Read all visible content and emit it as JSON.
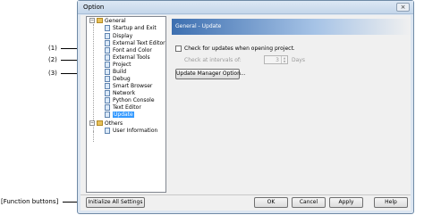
{
  "window": {
    "title": "Option",
    "close_glyph": "×"
  },
  "annotations": {
    "callout_1": "(1)",
    "callout_2": "(2)",
    "callout_3": "(3)",
    "function_buttons": "[Function buttons]"
  },
  "tree": {
    "general": {
      "label": "General",
      "items": [
        "Startup and Exit",
        "Display",
        "External Text Editor",
        "Font and Color",
        "External Tools",
        "Project",
        "Build",
        "Debug",
        "Smart Browser",
        "Network",
        "Python Console",
        "Text Editor",
        "Update"
      ],
      "selected": "Update"
    },
    "others": {
      "label": "Others",
      "items": [
        "User Information"
      ]
    },
    "expander_glyph": "−"
  },
  "page": {
    "header": "General - Update",
    "check_updates_label": "Check for updates when opening project.",
    "interval_label": "Check at intervals of:",
    "interval_value": "3",
    "interval_unit": "Days",
    "update_manager_button": "Update Manager Option..."
  },
  "footer": {
    "initialize_button": "Initialize All Settings",
    "ok_button": "OK",
    "cancel_button": "Cancel",
    "apply_button": "Apply",
    "help_button": "Help"
  }
}
